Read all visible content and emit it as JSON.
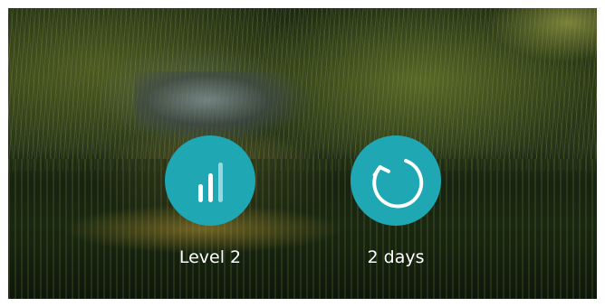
{
  "controls": {
    "level": {
      "label": "Level 2",
      "icon": "signal-bars-icon",
      "color": "#1fa7b4"
    },
    "days": {
      "label": "2 days",
      "icon": "refresh-icon",
      "color": "#1fa7b4"
    }
  }
}
